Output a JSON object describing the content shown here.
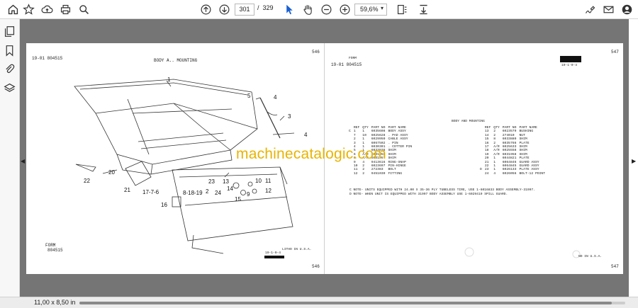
{
  "toolbar": {
    "icons": [
      "home-icon",
      "bookmark-star-icon",
      "upload-cloud-icon",
      "print-icon",
      "zoom-search-icon",
      "page-up-icon",
      "page-down-icon",
      "cursor-arrow-icon",
      "hand-icon",
      "zoom-out-icon",
      "zoom-in-icon",
      "fit-page-icon",
      "scroll-mode-icon",
      "sign-icon",
      "mail-icon",
      "account-icon"
    ],
    "current_page": "301",
    "page_separator": "/",
    "total_pages": "329",
    "zoom_level": "59,6%"
  },
  "sidebar": {
    "icons": [
      "copy-pages-icon",
      "bookmark-icon",
      "attachment-icon",
      "layers-icon"
    ]
  },
  "left_page": {
    "header_id": "19-01  804515",
    "title": "BODY A.. MOUNTING",
    "page_number": "546",
    "footer_form": "FORM",
    "footer_code": "804515",
    "footer_ref": "19-1-0-4",
    "footer_litho": "LITHO IN U.S.A.",
    "footer_page": "546",
    "callouts": [
      "1",
      "2",
      "3",
      "4",
      "5",
      "4",
      "20",
      "22",
      "21",
      "17-7-6",
      "16",
      "8-18-19",
      "2",
      "23",
      "24",
      "13",
      "14",
      "15",
      "9",
      "10",
      "11",
      "12"
    ]
  },
  "right_page": {
    "form_label": "FORM",
    "header_id": "19-01  804515",
    "header_ref": "19-1-0-4",
    "page_number": "547",
    "section_title": "BODY AND MOUNTING",
    "columns": [
      "REF",
      "QTY",
      "PART NO",
      "PART NAME"
    ],
    "rows_left": [
      [
        "C",
        "1",
        "1",
        "6035608",
        "BODY ASSY"
      ],
      [
        "",
        "7",
        "10",
        "6025628",
        ". PAD ASSY"
      ],
      [
        "",
        "2",
        "1",
        "6029950",
        "CABLE ASSY"
      ],
      [
        "",
        "3",
        "1",
        "6067502",
        ". PIN"
      ],
      [
        "",
        "4",
        "1",
        "6030301",
        ". COTTER PIN"
      ],
      [
        "",
        "5",
        "1",
        "6033936",
        "SHIM"
      ],
      [
        "",
        "6",
        "A/R",
        "6031956",
        "SHIM"
      ],
      [
        "",
        "8",
        "A/R",
        "6031957",
        "SHIM"
      ],
      [
        "",
        "9",
        "4",
        "9413616",
        "RING-SNAP"
      ],
      [
        "",
        "10",
        "2",
        "6023697",
        "PIN-HINGE"
      ],
      [
        "",
        "11",
        "2",
        "272383",
        "BOLT"
      ],
      [
        "",
        "12",
        "2",
        "9451030",
        "FITTING"
      ]
    ],
    "rows_right": [
      [
        "",
        "13",
        "2",
        "6023579",
        "BUSHING"
      ],
      [
        "",
        "14",
        "2",
        "274010",
        "NUT"
      ],
      [
        "",
        "15",
        "8",
        "6033880",
        "SHIM"
      ],
      [
        "",
        "16",
        "2",
        "6035766",
        "PLATE"
      ],
      [
        "",
        "17",
        "A/R",
        "6025633",
        "SHIM"
      ],
      [
        "",
        "18",
        "A/R",
        "6025558",
        "SHIM"
      ],
      [
        "",
        "19",
        "A/R",
        "6031958",
        "SHIM"
      ],
      [
        "",
        "20",
        "1",
        "6044821",
        "PLATE"
      ],
      [
        "",
        "21",
        "1",
        "6064846",
        "GUARD ASSY"
      ],
      [
        "",
        "22",
        "1",
        "6064845",
        "GUARD ASSY"
      ],
      [
        "D",
        "23",
        "1",
        "6026133",
        "PLATE ASSY"
      ],
      [
        "",
        "24",
        "4",
        "6026056",
        "BOLT-12 POINT"
      ]
    ],
    "note_c": "C  NOTE- UNITS EQUIPPED WITH 24.00 X 35-36 PLY TUBELESS TIRE, USE 1-6016833 BODY ASSEMBLY-31997.",
    "note_d": "D  NOTE- WHEN UNIT IS EQUIPPED WITH 31997 BODY ASSEMBLY USE 1-6029419 SPILL GUARD.",
    "footer_litho": "NO IN U.S.A.",
    "footer_page": "547"
  },
  "watermark": "machinecatalogic.com",
  "statusbar": {
    "page_size": "11,00 x 8,50 in",
    "scroll_fraction": 0.975
  }
}
